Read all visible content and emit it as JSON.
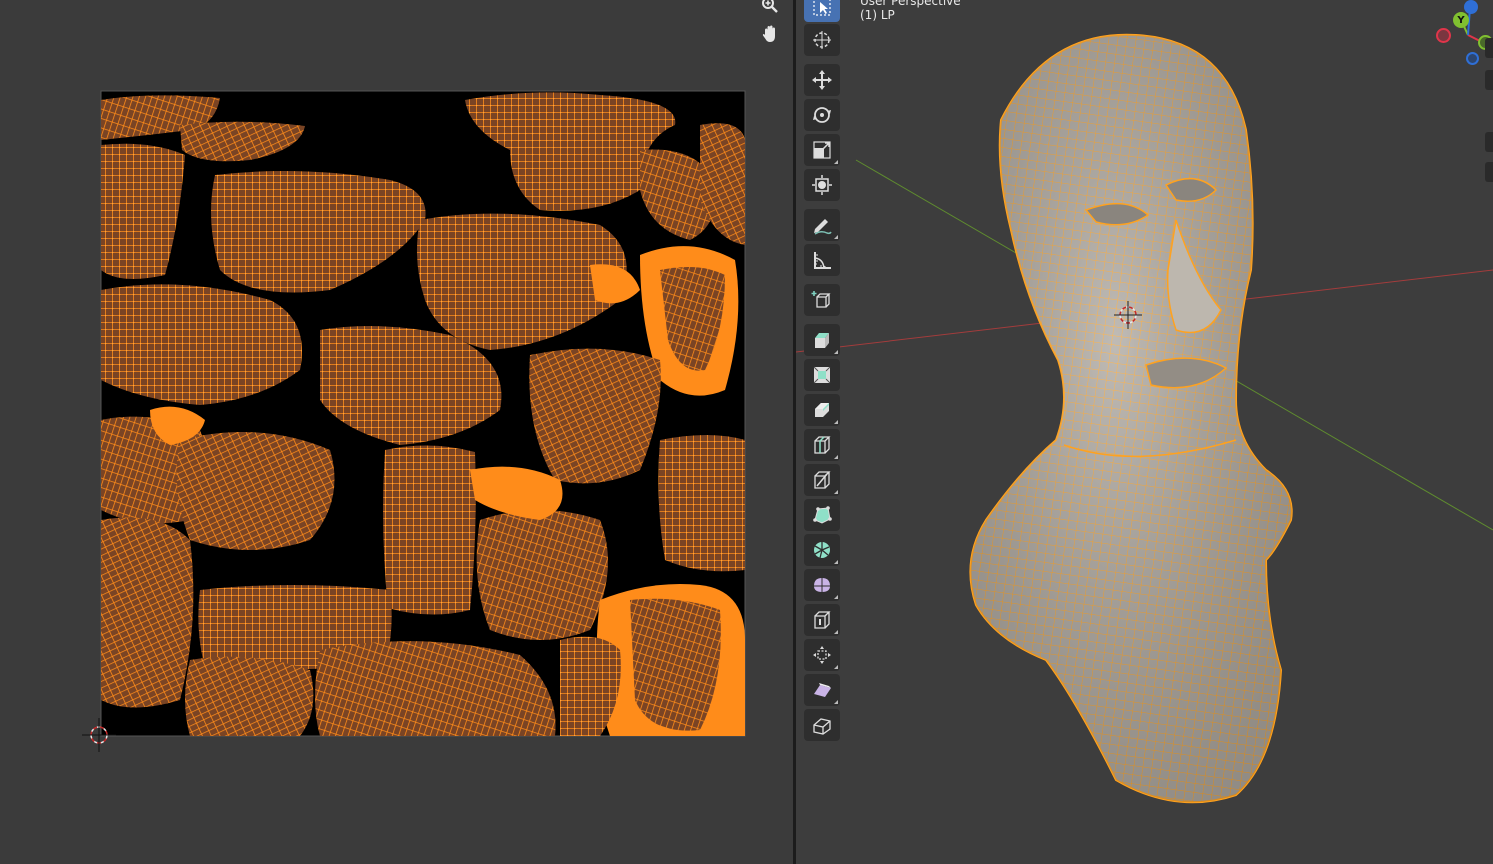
{
  "uv_editor": {
    "navigation": [
      {
        "name": "zoom",
        "icon": "zoom-icon"
      },
      {
        "name": "pan",
        "icon": "hand-icon"
      }
    ],
    "colors": {
      "background": "#3b3b3b",
      "uv_image": "#000000",
      "uv_selected": "#ff8c1a",
      "uv_face": "#7a4424"
    }
  },
  "viewport": {
    "view_info": {
      "title": "User Perspective",
      "object": "(1) LP"
    },
    "toolbar": [
      {
        "name": "select-box",
        "icon": "select-box-icon",
        "active": true
      },
      {
        "name": "cursor",
        "icon": "cursor-icon"
      },
      {
        "name": "move",
        "icon": "move-icon"
      },
      {
        "name": "rotate",
        "icon": "rotate-icon"
      },
      {
        "name": "scale",
        "icon": "scale-icon"
      },
      {
        "name": "transform",
        "icon": "transform-icon"
      },
      {
        "name": "annotate",
        "icon": "annotate-icon"
      },
      {
        "name": "measure",
        "icon": "measure-icon"
      },
      {
        "name": "add-cube",
        "icon": "add-cube-icon"
      },
      {
        "name": "extrude-region",
        "icon": "extrude-icon"
      },
      {
        "name": "inset-faces",
        "icon": "inset-icon"
      },
      {
        "name": "bevel",
        "icon": "bevel-icon"
      },
      {
        "name": "loop-cut",
        "icon": "loop-cut-icon"
      },
      {
        "name": "knife",
        "icon": "knife-icon"
      },
      {
        "name": "poly-build",
        "icon": "poly-build-icon"
      },
      {
        "name": "spin",
        "icon": "spin-icon"
      },
      {
        "name": "smooth",
        "icon": "smooth-icon"
      },
      {
        "name": "edge-slide",
        "icon": "edge-slide-icon"
      },
      {
        "name": "shrink-fatten",
        "icon": "shrink-fatten-icon"
      },
      {
        "name": "shear",
        "icon": "shear-icon"
      },
      {
        "name": "rip-region",
        "icon": "rip-icon"
      }
    ],
    "gizmo": {
      "y_label": "Y",
      "colors": {
        "x": "#e0354a",
        "y": "#80c030",
        "z": "#2f6fd6",
        "neg_x": "#9a3a45",
        "neg_z": "#3e5f9c"
      }
    },
    "colors": {
      "background": "#3d3d3d",
      "wire": "#ffa21f",
      "mesh": "#a9a39b",
      "x_axis": "#a33c3c",
      "y_axis": "#5f8c2f"
    }
  }
}
